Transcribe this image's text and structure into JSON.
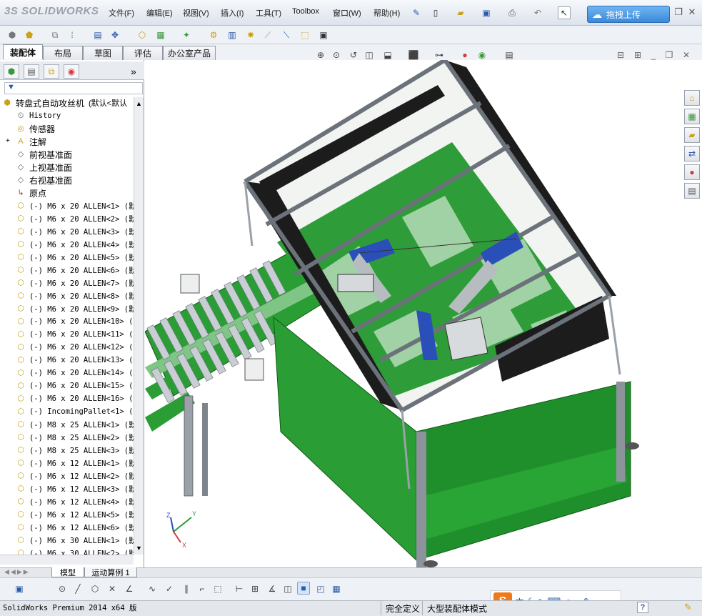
{
  "app": {
    "logo_text": "SOLIDWORKS",
    "logo_prefix": "3S"
  },
  "menu": [
    {
      "label": "文件(F)"
    },
    {
      "label": "编辑(E)"
    },
    {
      "label": "视图(V)"
    },
    {
      "label": "插入(I)"
    },
    {
      "label": "工具(T)"
    },
    {
      "label": "Toolbox"
    },
    {
      "label": "窗口(W)"
    },
    {
      "label": "帮助(H)"
    }
  ],
  "upload_button": {
    "label": "拖拽上传"
  },
  "command_tabs": [
    {
      "label": "装配体",
      "active": true
    },
    {
      "label": "布局"
    },
    {
      "label": "草图"
    },
    {
      "label": "评估"
    },
    {
      "label": "办公室产品"
    }
  ],
  "feature_tree": {
    "more_symbol": "»",
    "filter_symbol": "▼",
    "root": {
      "label": "转盘式自动攻丝机",
      "config": "(默认<默认"
    },
    "items": [
      {
        "icon": "history-icon",
        "glyph": "⏲",
        "label": "History",
        "cn": false
      },
      {
        "icon": "sensor-icon",
        "glyph": "◎",
        "label": "传感器",
        "cn": true
      },
      {
        "icon": "annotation-icon",
        "glyph": "A",
        "label": "注解",
        "cn": true
      },
      {
        "icon": "plane-icon",
        "glyph": "◇",
        "label": "前视基准面",
        "cn": true
      },
      {
        "icon": "plane-icon",
        "glyph": "◇",
        "label": "上视基准面",
        "cn": true
      },
      {
        "icon": "plane-icon",
        "glyph": "◇",
        "label": "右视基准面",
        "cn": true
      },
      {
        "icon": "origin-icon",
        "glyph": "↳",
        "label": "原点",
        "cn": true
      },
      {
        "icon": "part-icon",
        "glyph": "⬡",
        "label": "(-) M6 x 20 ALLEN<1> (默"
      },
      {
        "icon": "part-icon",
        "glyph": "⬡",
        "label": "(-) M6 x 20 ALLEN<2> (默"
      },
      {
        "icon": "part-icon",
        "glyph": "⬡",
        "label": "(-) M6 x 20 ALLEN<3> (默"
      },
      {
        "icon": "part-icon",
        "glyph": "⬡",
        "label": "(-) M6 x 20 ALLEN<4> (默"
      },
      {
        "icon": "part-icon",
        "glyph": "⬡",
        "label": "(-) M6 x 20 ALLEN<5> (默"
      },
      {
        "icon": "part-icon",
        "glyph": "⬡",
        "label": "(-) M6 x 20 ALLEN<6> (默"
      },
      {
        "icon": "part-icon",
        "glyph": "⬡",
        "label": "(-) M6 x 20 ALLEN<7> (默"
      },
      {
        "icon": "part-icon",
        "glyph": "⬡",
        "label": "(-) M6 x 20 ALLEN<8> (默"
      },
      {
        "icon": "part-icon",
        "glyph": "⬡",
        "label": "(-) M6 x 20 ALLEN<9> (默"
      },
      {
        "icon": "part-icon",
        "glyph": "⬡",
        "label": "(-) M6 x 20 ALLEN<10> ("
      },
      {
        "icon": "part-icon",
        "glyph": "⬡",
        "label": "(-) M6 x 20 ALLEN<11> ("
      },
      {
        "icon": "part-icon",
        "glyph": "⬡",
        "label": "(-) M6 x 20 ALLEN<12> ("
      },
      {
        "icon": "part-icon",
        "glyph": "⬡",
        "label": "(-) M6 x 20 ALLEN<13> ("
      },
      {
        "icon": "part-icon",
        "glyph": "⬡",
        "label": "(-) M6 x 20 ALLEN<14> ("
      },
      {
        "icon": "part-icon",
        "glyph": "⬡",
        "label": "(-) M6 x 20 ALLEN<15> ("
      },
      {
        "icon": "part-icon",
        "glyph": "⬡",
        "label": "(-) M6 x 20 ALLEN<16> ("
      },
      {
        "icon": "part-icon",
        "glyph": "⬡",
        "label": "(-) IncomingPallet<1> ("
      },
      {
        "icon": "part-icon",
        "glyph": "⬡",
        "label": "(-) M8 x 25 ALLEN<1> (默"
      },
      {
        "icon": "part-icon",
        "glyph": "⬡",
        "label": "(-) M8 x 25 ALLEN<2> (默"
      },
      {
        "icon": "part-icon",
        "glyph": "⬡",
        "label": "(-) M8 x 25 ALLEN<3> (默"
      },
      {
        "icon": "part-icon",
        "glyph": "⬡",
        "label": "(-) M6 x 12 ALLEN<1> (默"
      },
      {
        "icon": "part-icon",
        "glyph": "⬡",
        "label": "(-) M6 x 12 ALLEN<2> (默"
      },
      {
        "icon": "part-icon",
        "glyph": "⬡",
        "label": "(-) M6 x 12 ALLEN<3> (默"
      },
      {
        "icon": "part-icon",
        "glyph": "⬡",
        "label": "(-) M6 x 12 ALLEN<4> (默"
      },
      {
        "icon": "part-icon",
        "glyph": "⬡",
        "label": "(-) M6 x 12 ALLEN<5> (默"
      },
      {
        "icon": "part-icon",
        "glyph": "⬡",
        "label": "(-) M6 x 12 ALLEN<6> (默"
      },
      {
        "icon": "part-icon",
        "glyph": "⬡",
        "label": "(-) M6 x 30 ALLEN<1> (默"
      },
      {
        "icon": "part-icon",
        "glyph": "⬡",
        "label": "(-) M6 x 30 ALLEN<2> (默"
      }
    ]
  },
  "bottom_tabs": [
    {
      "label": "模型"
    },
    {
      "label": "运动算例 1"
    }
  ],
  "status": {
    "product": "SolidWorks Premium 2014 x64 版",
    "state": "完全定义",
    "mode": "大型装配体模式"
  },
  "ime": {
    "logo": "S",
    "lang": "中"
  },
  "axis": {
    "x": "X",
    "y": "Y",
    "z": "Z"
  },
  "colors": {
    "frame_green": "#1f9a2a",
    "panel_black": "#1c1c1c",
    "rail_gray": "#8c939b",
    "accent_blue": "#2b4fb8"
  }
}
